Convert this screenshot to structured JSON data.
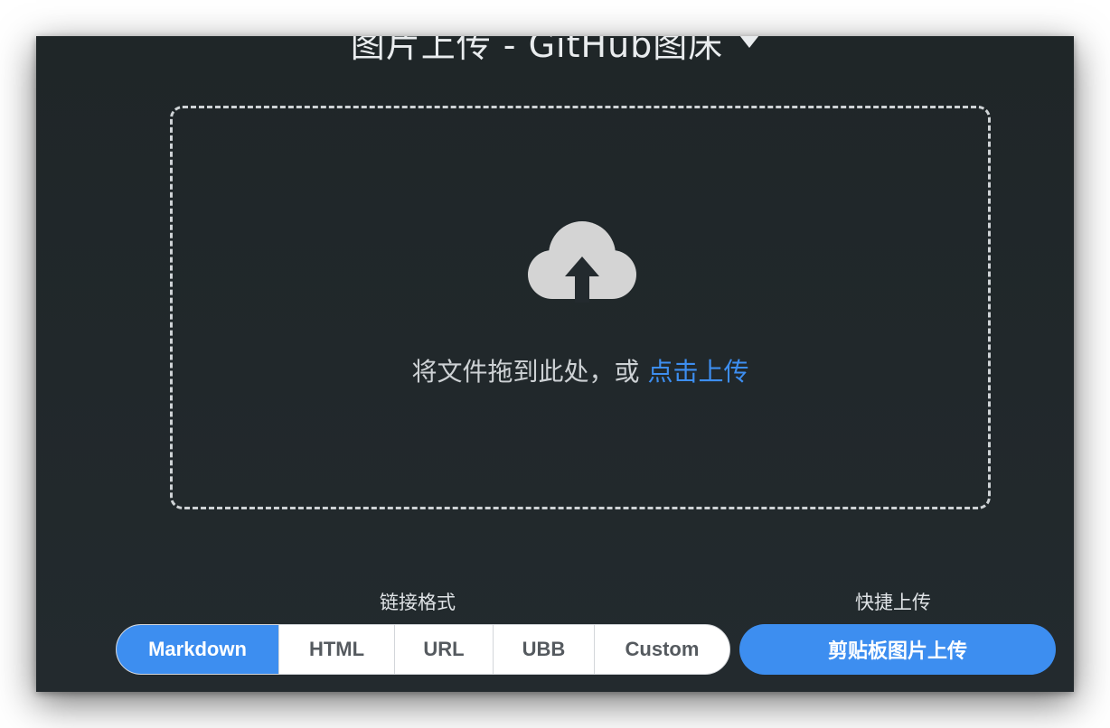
{
  "header": {
    "title": "图片上传 - GitHub图床"
  },
  "dropzone": {
    "icon": "cloud-upload-icon",
    "text": "将文件拖到此处，或",
    "link": "点击上传"
  },
  "link_format": {
    "label": "链接格式",
    "options": [
      "Markdown",
      "HTML",
      "URL",
      "UBB",
      "Custom"
    ],
    "selected": "Markdown"
  },
  "quick_upload": {
    "label": "快捷上传",
    "button": "剪贴板图片上传"
  },
  "colors": {
    "background": "#232a2e",
    "accent": "#3d8ef0",
    "icon": "#d4d4d4"
  }
}
